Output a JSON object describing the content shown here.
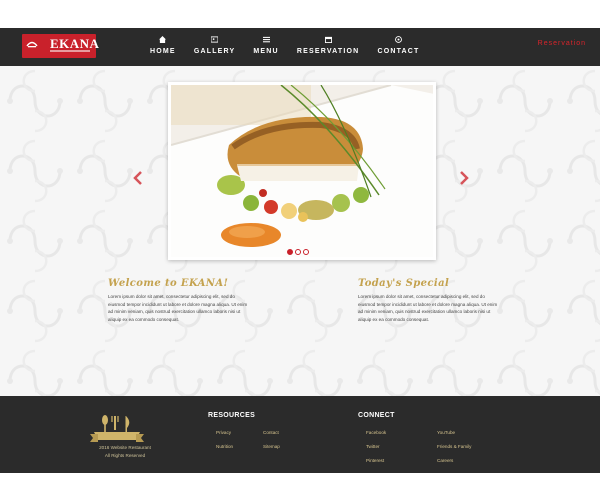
{
  "header": {
    "logo_text": "EKANA",
    "nav": [
      {
        "label": "HOME",
        "icon": "home-icon"
      },
      {
        "label": "GALLERY",
        "icon": "gallery-icon"
      },
      {
        "label": "MENU",
        "icon": "menu-icon"
      },
      {
        "label": "RESERVATION",
        "icon": "reservation-icon"
      },
      {
        "label": "CONTACT",
        "icon": "contact-icon"
      }
    ],
    "reservation_link": "Reservation"
  },
  "slider": {
    "active_slide": 1,
    "slide_count": 3
  },
  "welcome": {
    "title": "Welcome to EKANA!",
    "text": "Lorem ipsum dolor sit amet, consectetur adipiscing elit, sed do eiusmod tempor incididunt ut labore et dolore magna aliqua. Ut enim ad minim veniam, quis nostrud exercitation ullamco laboris nisi ut aliquip ex ea commodo consequat."
  },
  "special": {
    "title": "Today's Special",
    "text": "Lorem ipsum dolor sit amet, consectetur adipiscing elit, sed do eiusmod tempor incididunt ut labore et dolore magna aliqua. Ut enim ad minim veniam, quis nostrud exercitation ullamco laboris nisi ut aliquip ex ea commodo consequat."
  },
  "footer": {
    "copyright_line1": "2016 Website Restaurant",
    "copyright_line2": "All Rights Reserved",
    "resources_title": "RESOURCES",
    "resources_links": [
      "Privacy",
      "Contact",
      "Nutrition",
      "Sitemap"
    ],
    "connect_title": "CONNECT",
    "connect_links": [
      "Facebook",
      "YouTube",
      "Twitter",
      "Friends & Family",
      "Pinterest",
      "Careers"
    ]
  },
  "colors": {
    "brand_red": "#c9212b",
    "gold": "#c4a24e",
    "dark": "#2b2b2b"
  }
}
